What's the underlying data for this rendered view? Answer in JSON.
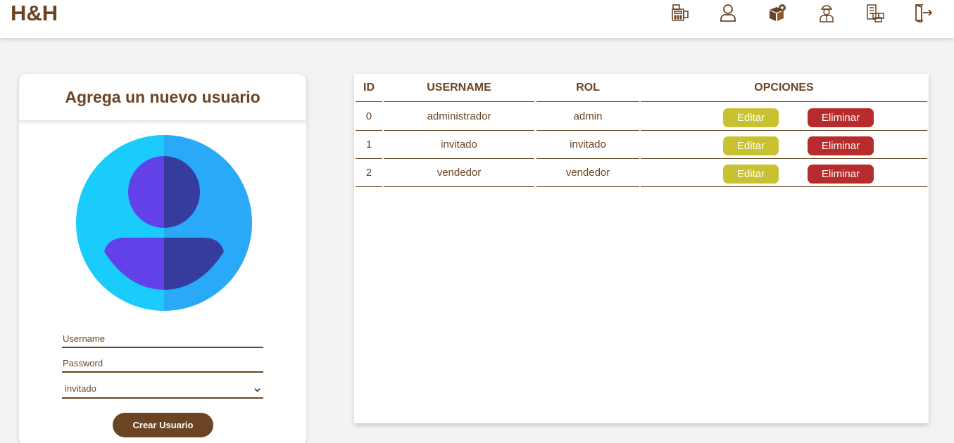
{
  "header": {
    "brand": "H&H",
    "nav_icons": [
      "cash-register-icon",
      "user-icon",
      "add-product-icon",
      "worker-icon",
      "inventory-icon",
      "logout-icon"
    ]
  },
  "form": {
    "title": "Agrega un nuevo usuario",
    "username_placeholder": "Username",
    "password_placeholder": "Password",
    "role_selected": "invitado",
    "submit_label": "Crear Usuario"
  },
  "table": {
    "headers": [
      "ID",
      "USERNAME",
      "ROL",
      "OPCIONES"
    ],
    "rows": [
      {
        "id": "0",
        "username": "administrador",
        "rol": "admin"
      },
      {
        "id": "1",
        "username": "invitado",
        "rol": "invitado"
      },
      {
        "id": "2",
        "username": "vendedor",
        "rol": "vendedor"
      }
    ],
    "edit_label": "Editar",
    "delete_label": "Eliminar"
  },
  "colors": {
    "brand_brown": "#6b4423",
    "edit_yellow": "#c9c230",
    "delete_red": "#b62b2b",
    "avatar_light": "#19ccfc",
    "avatar_dark": "#2aa9f9",
    "figure_light": "#6241e8",
    "figure_dark": "#353c9e"
  }
}
